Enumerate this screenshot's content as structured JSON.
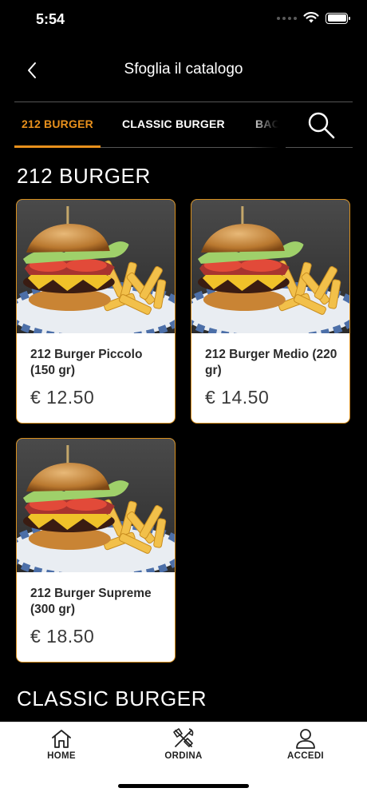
{
  "status": {
    "time": "5:54"
  },
  "nav": {
    "title": "Sfoglia il catalogo"
  },
  "tabs": [
    {
      "label": "212 BURGER",
      "active": true
    },
    {
      "label": "CLASSIC BURGER",
      "active": false
    },
    {
      "label": "BACON",
      "active": false
    }
  ],
  "sections": [
    {
      "title": "212 BURGER",
      "products": [
        {
          "name": "212 Burger Piccolo (150 gr)",
          "price": "€ 12.50"
        },
        {
          "name": "212 Burger Medio (220 gr)",
          "price": "€ 14.50"
        },
        {
          "name": "212 Burger Supreme (300 gr)",
          "price": "€ 18.50"
        }
      ]
    },
    {
      "title": "CLASSIC BURGER",
      "products": []
    }
  ],
  "bottom_nav": [
    {
      "label": "HOME",
      "icon": "home-icon"
    },
    {
      "label": "ORDINA",
      "icon": "utensils-icon"
    },
    {
      "label": "ACCEDI",
      "icon": "user-icon"
    }
  ],
  "colors": {
    "accent": "#e8901c",
    "background": "#000000",
    "card": "#ffffff"
  }
}
